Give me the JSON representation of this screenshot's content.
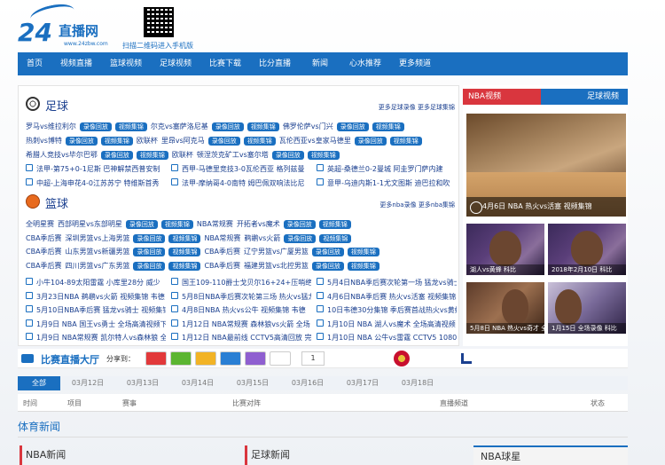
{
  "logo": {
    "number": "24",
    "name": "直播网",
    "url": "www.24zbw.com"
  },
  "qr_tip": "扫描二维码进入手机版",
  "nav": [
    "首页",
    "视频直播",
    "篮球视频",
    "足球视频",
    "比赛下载",
    "比分直播",
    "新闻",
    "心水推荐",
    "更多频道"
  ],
  "football": {
    "title": "足球",
    "more": "更多足球录像 更多足球集锦",
    "rows": [
      [
        "罗马vs维拉利尔",
        "录像回放",
        "视频集锦",
        "尔克vs塞萨洛尼基",
        "录像回放",
        "视频集锦",
        "佛罗伦萨vs门兴",
        "录像回放",
        "视频集锦"
      ],
      [
        "热刺vs博特",
        "录像回放",
        "视频集锦",
        "欧联杯",
        "里昂vs阿克马",
        "录像回放",
        "视频集锦",
        "瓦伦西亚vs皇家马德里",
        "录像回放",
        "视频集锦"
      ],
      [
        "希腊人竞技vs毕尔巴鄂",
        "录像回放",
        "视频集锦",
        "欧联杯",
        "顿涅茨克矿工vs塞尔塔",
        "录像回放",
        "视频集锦"
      ]
    ],
    "lines": [
      [
        "法甲-第75+0-1尼斯 巴神解禁西普安制",
        "西甲-马德里竞技3-0瓦伦西亚 格列兹曼",
        "英超-桑德兰0-2曼城 阿圭罗门萨内建"
      ],
      [
        "中超-上海申花4-0江苏苏宁 特维斯首秀",
        "法甲-摩纳哥4-0南特 姆巴佩双响法比尼",
        "意甲-乌迪内斯1-1尤文图斯 迪巴拉和吹"
      ]
    ]
  },
  "basketball": {
    "title": "篮球",
    "more": "更多nba录像 更多nba集锦",
    "rows": [
      [
        "全明星赛",
        "西部明星vs东部明星",
        "录像回放",
        "视频集锦",
        "NBA常规赛",
        "开拓者vs魔术",
        "录像回放",
        "视频集锦"
      ],
      [
        "CBA季后赛",
        "深圳男篮vs上海男篮",
        "录像回放",
        "视频集锦",
        "NBA常规赛",
        "鹈鹕vs火箭",
        "录像回放",
        "视频集锦"
      ],
      [
        "CBA季后赛",
        "山东男篮vs新疆男篮",
        "录像回放",
        "视频集锦",
        "CBA季后赛",
        "辽宁男篮vs广厦男篮",
        "录像回放",
        "视频集锦"
      ],
      [
        "CBA季后赛",
        "四川男篮vs广东男篮",
        "录像回放",
        "视频集锦",
        "CBA季后赛",
        "福建男篮vs北控男篮",
        "录像回放",
        "视频集锦"
      ]
    ],
    "lines": [
      [
        "小牛104-89太阳雷霆 小库里28分 威少",
        "国王109-110爵士戈贝尔16+24+压哨绝杀",
        "5月4日NBA季后赛次轮第一场 猛龙vs骑士"
      ],
      [
        "3月23日NBA 鹈鹕vs火箭 视频集锦 韦德",
        "5月8日NBA季后赛次轮第三场 热火vs猛龙",
        "4月6日NBA季后赛 热火vs活塞 视频集锦 韦德复"
      ],
      [
        "5月10日NBA季后赛 猛龙vs骑士 视频集锦 韦德",
        "4月8日NBA 热火vs公牛 视频集锦 韦德",
        "10日韦德30分集锦 季后赛首战热火vs黄蜂"
      ],
      [
        "1月9日 NBA 国王vs勇士 全场高清视频下",
        "1月12日 NBA常规赛 森林狼vs火箭 全场",
        "1月10日 NBA 湖人vs魔术 全场高清视频"
      ],
      [
        "1月9日 NBA常规赛 凯尔特人vs森林狼 全",
        "1月12日 NBA最前线 CCTV5高清回放 完整",
        "1月10日 NBA 公牛vs雷霆 CCTV5 1080I"
      ]
    ]
  },
  "side": {
    "tabs": [
      "NBA视频",
      "足球视频"
    ],
    "big_caption": "4月6日 NBA 热火vs活塞 视频集锦",
    "thumbs": [
      "湖人vs黄蜂 科比",
      "2018年2月10日 科比",
      "5月8日 NBA 热火vs奇才 全场录像",
      "1月15日 全场录像 科比"
    ]
  },
  "live": {
    "title": "比赛直播大厅",
    "share_label": "分享到：",
    "count": "1"
  },
  "dates": [
    "全部",
    "03月12日",
    "03月13日",
    "03月14日",
    "03月15日",
    "03月16日",
    "03月17日",
    "03月18日"
  ],
  "table_head": [
    "时间",
    "项目",
    "赛事",
    "比赛对阵",
    "直播频道",
    "状态"
  ],
  "news": {
    "title": "体育新闻",
    "cols": [
      "NBA新闻",
      "足球新闻",
      "NBA球星"
    ]
  },
  "colors": {
    "primary": "#1a6fc0",
    "accent": "#d9363e"
  }
}
